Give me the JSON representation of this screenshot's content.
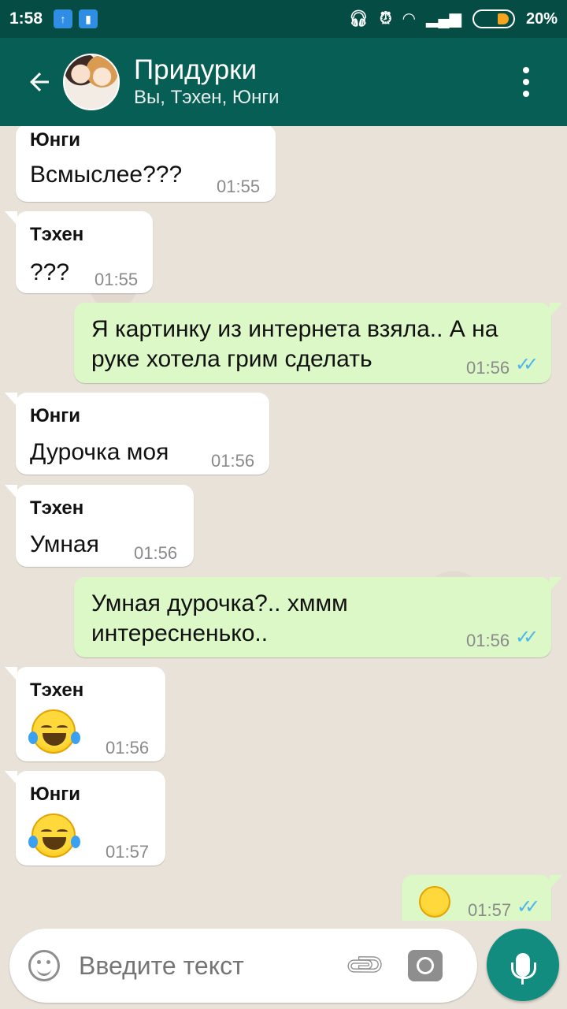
{
  "status_bar": {
    "time": "1:58",
    "battery_percent": "20%",
    "icons": [
      "upload-icon",
      "notes-icon",
      "headphones-icon",
      "alarm-icon",
      "wifi-icon",
      "signal-icon",
      "battery-icon"
    ]
  },
  "header": {
    "title": "Придурки",
    "subtitle": "Вы, Тэхен, Юнги",
    "back_icon": "arrow-back-icon",
    "menu_icon": "more-vert-icon"
  },
  "messages": [
    {
      "direction": "in",
      "sender": "Юнги",
      "text": "Всмыслее???",
      "time": "01:55"
    },
    {
      "direction": "in",
      "sender": "Тэхен",
      "text": "???",
      "time": "01:55"
    },
    {
      "direction": "out",
      "text_line1": "Я картинку из интернета взяла.. А на",
      "text_line2": "руке хотела грим сделать",
      "time": "01:56",
      "status": "read"
    },
    {
      "direction": "in",
      "sender": "Юнги",
      "text": "Дурочка моя",
      "time": "01:56"
    },
    {
      "direction": "in",
      "sender": "Тэхен",
      "text": "Умная",
      "time": "01:56"
    },
    {
      "direction": "out",
      "text_line1": "Умная дурочка?.. хммм",
      "text_line2": "интересненько..",
      "time": "01:56",
      "status": "read"
    },
    {
      "direction": "in",
      "sender": "Тэхен",
      "emoji": "😂",
      "time": "01:56"
    },
    {
      "direction": "in",
      "sender": "Юнги",
      "emoji": "😂",
      "time": "01:57"
    },
    {
      "direction": "out",
      "emoji": "☺️",
      "time": "01:57",
      "status": "read"
    }
  ],
  "composer": {
    "placeholder": "Введите текст",
    "emoji_icon": "smiley-icon",
    "attach_icon": "paperclip-icon",
    "camera_icon": "camera-icon",
    "mic_icon": "microphone-icon"
  },
  "colors": {
    "status_bar": "#054d44",
    "header": "#075e54",
    "outgoing_bubble": "#dcf8c6",
    "incoming_bubble": "#ffffff",
    "read_ticks": "#4fb6ec",
    "mic_button": "#128c7e"
  }
}
